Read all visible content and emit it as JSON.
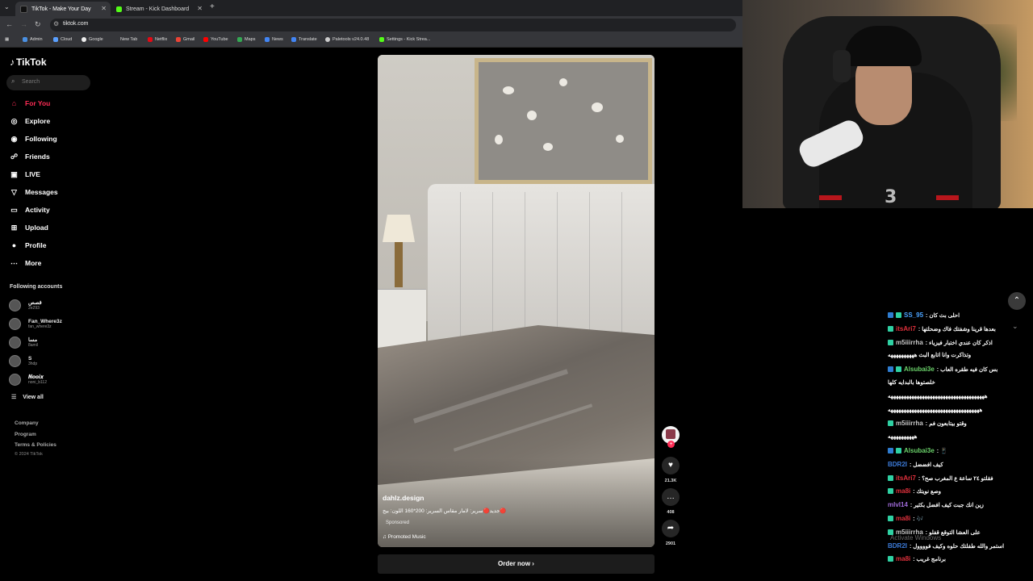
{
  "browser": {
    "tabs": [
      {
        "label": "TikTok - Make Your Day",
        "active": true,
        "icon": "tiktok-icon"
      },
      {
        "label": "Stream - Kick Dashboard",
        "active": false,
        "icon": "kick-icon"
      }
    ],
    "url": "tiktok.com",
    "bookmarks": [
      "Admin",
      "Cloud",
      "Google",
      "New Tab",
      "Netflix",
      "Gmail",
      "YouTube",
      "Maps",
      "News",
      "Translate",
      "Paletools v24.0.48",
      "Settings - Kick Strea..."
    ]
  },
  "sidebar": {
    "logo": "TikTok",
    "search_placeholder": "Search",
    "nav": [
      {
        "label": "For You",
        "icon": "home-icon",
        "active": true
      },
      {
        "label": "Explore",
        "icon": "compass-icon"
      },
      {
        "label": "Following",
        "icon": "following-icon"
      },
      {
        "label": "Friends",
        "icon": "friends-icon"
      },
      {
        "label": "LIVE",
        "icon": "live-icon"
      },
      {
        "label": "Messages",
        "icon": "messages-icon"
      },
      {
        "label": "Activity",
        "icon": "activity-icon"
      },
      {
        "label": "Upload",
        "icon": "upload-icon"
      },
      {
        "label": "Profile",
        "icon": "profile-icon"
      },
      {
        "label": "More",
        "icon": "more-icon"
      }
    ],
    "following_title": "Following accounts",
    "accounts": [
      {
        "name": "قصص",
        "handle": "2e293"
      },
      {
        "name": "Fan_Where3z",
        "handle": "fan_where3z"
      },
      {
        "name": "ﻣﺴﺎ",
        "handle": "8amil"
      },
      {
        "name": "S",
        "handle": "3hdp"
      },
      {
        "name": "𝑵𝒐𝒐𝒊𝒙",
        "handle": "noni_b112"
      }
    ],
    "view_all": "View all",
    "footer_links": [
      "Company",
      "Program",
      "Terms & Policies"
    ],
    "copyright": "© 2024 TikTok"
  },
  "video": {
    "username": "dahlz.design",
    "description": "جديد🔴سرير: لامار مقاس السرير: 200*160 اللون: بيج🔴",
    "sponsored": "Sponsored",
    "music": "Promoted Music",
    "cta": "Order now",
    "likes": "21.3K",
    "comments": "408",
    "shares": "2901"
  },
  "stream": {
    "overlay_logo": "3"
  },
  "chat": {
    "messages": [
      {
        "user": "SS_95",
        "color": "#4aa3ff",
        "text": "احلى بث كان",
        "badges": [
          "#2f7dd1",
          "#2fd1a3"
        ]
      },
      {
        "user": "itsAri7",
        "color": "#e0303c",
        "text": "بعدها قرينا وشفتك فاك وضحلتها",
        "badges": [
          "#2fd1a3"
        ]
      },
      {
        "user": "m5iiirrha",
        "color": "#c8c8c8",
        "text": "اذكر كان عندي اختبار فيزياء",
        "badges": [
          "#2fd1a3"
        ]
      },
      {
        "user": "",
        "color": "#c8c8c8",
        "text": "وتذاكرت وانا اتابع البث ههههههههههه",
        "badges": []
      },
      {
        "user": "Alsubai3e",
        "color": "#6bd36b",
        "text": "بس كان فيه طقره العاب",
        "badges": [
          "#2f7dd1",
          "#2fd1a3"
        ]
      },
      {
        "user": "",
        "color": "#c8c8c8",
        "text": "خلصتوها بالبدايه كلها",
        "badges": []
      },
      {
        "user": "",
        "color": "#c8c8c8",
        "text": "هههههههههههههههههههههههههههههههههههههه",
        "badges": []
      },
      {
        "user": "",
        "color": "#c8c8c8",
        "text": "هههههههههههههههههههههههههههههههههههه",
        "badges": []
      },
      {
        "user": "m5iiirrha",
        "color": "#c8c8c8",
        "text": "وقتو بيتابعون فم",
        "badges": [
          "#2fd1a3"
        ]
      },
      {
        "user": "",
        "color": "#c8c8c8",
        "text": "ههههههههههه",
        "badges": []
      },
      {
        "user": "Alsubai3e",
        "color": "#6bd36b",
        "text": "📱",
        "badges": [
          "#2f7dd1",
          "#2fd1a3"
        ]
      },
      {
        "user": "BDR2I",
        "color": "#3c7bd9",
        "text": "كيف افضضل",
        "badges": []
      },
      {
        "user": "itsAri7",
        "color": "#e0303c",
        "text": "فقلتو ٢٤ ساعة ع المغرب صح؟",
        "badges": [
          "#2fd1a3"
        ]
      },
      {
        "user": "ma8i",
        "color": "#e0303c",
        "text": "وصع نويتك",
        "badges": [
          "#2fd1a3"
        ]
      },
      {
        "user": "mlvl14",
        "color": "#a06bd9",
        "text": "زين انك جبت كيف افضل بكثير",
        "badges": []
      },
      {
        "user": "ma8i",
        "color": "#e0303c",
        "text": "🎶",
        "badges": [
          "#2fd1a3"
        ]
      },
      {
        "user": "m5iiirrha",
        "color": "#c8c8c8",
        "text": "على العشا التوقع قفلو",
        "badges": [
          "#2fd1a3"
        ]
      },
      {
        "user": "BDR2I",
        "color": "#3c7bd9",
        "text": "استمر والله طفلتك حلوه وكيف فوووول",
        "badges": []
      },
      {
        "user": "ma8i",
        "color": "#e0303c",
        "text": "برنامج غريب",
        "badges": [
          "#2fd1a3"
        ]
      }
    ],
    "watermark": "Activate Windows"
  },
  "colors": {
    "accent": "#fe2c55",
    "page_bg": "#000000"
  }
}
